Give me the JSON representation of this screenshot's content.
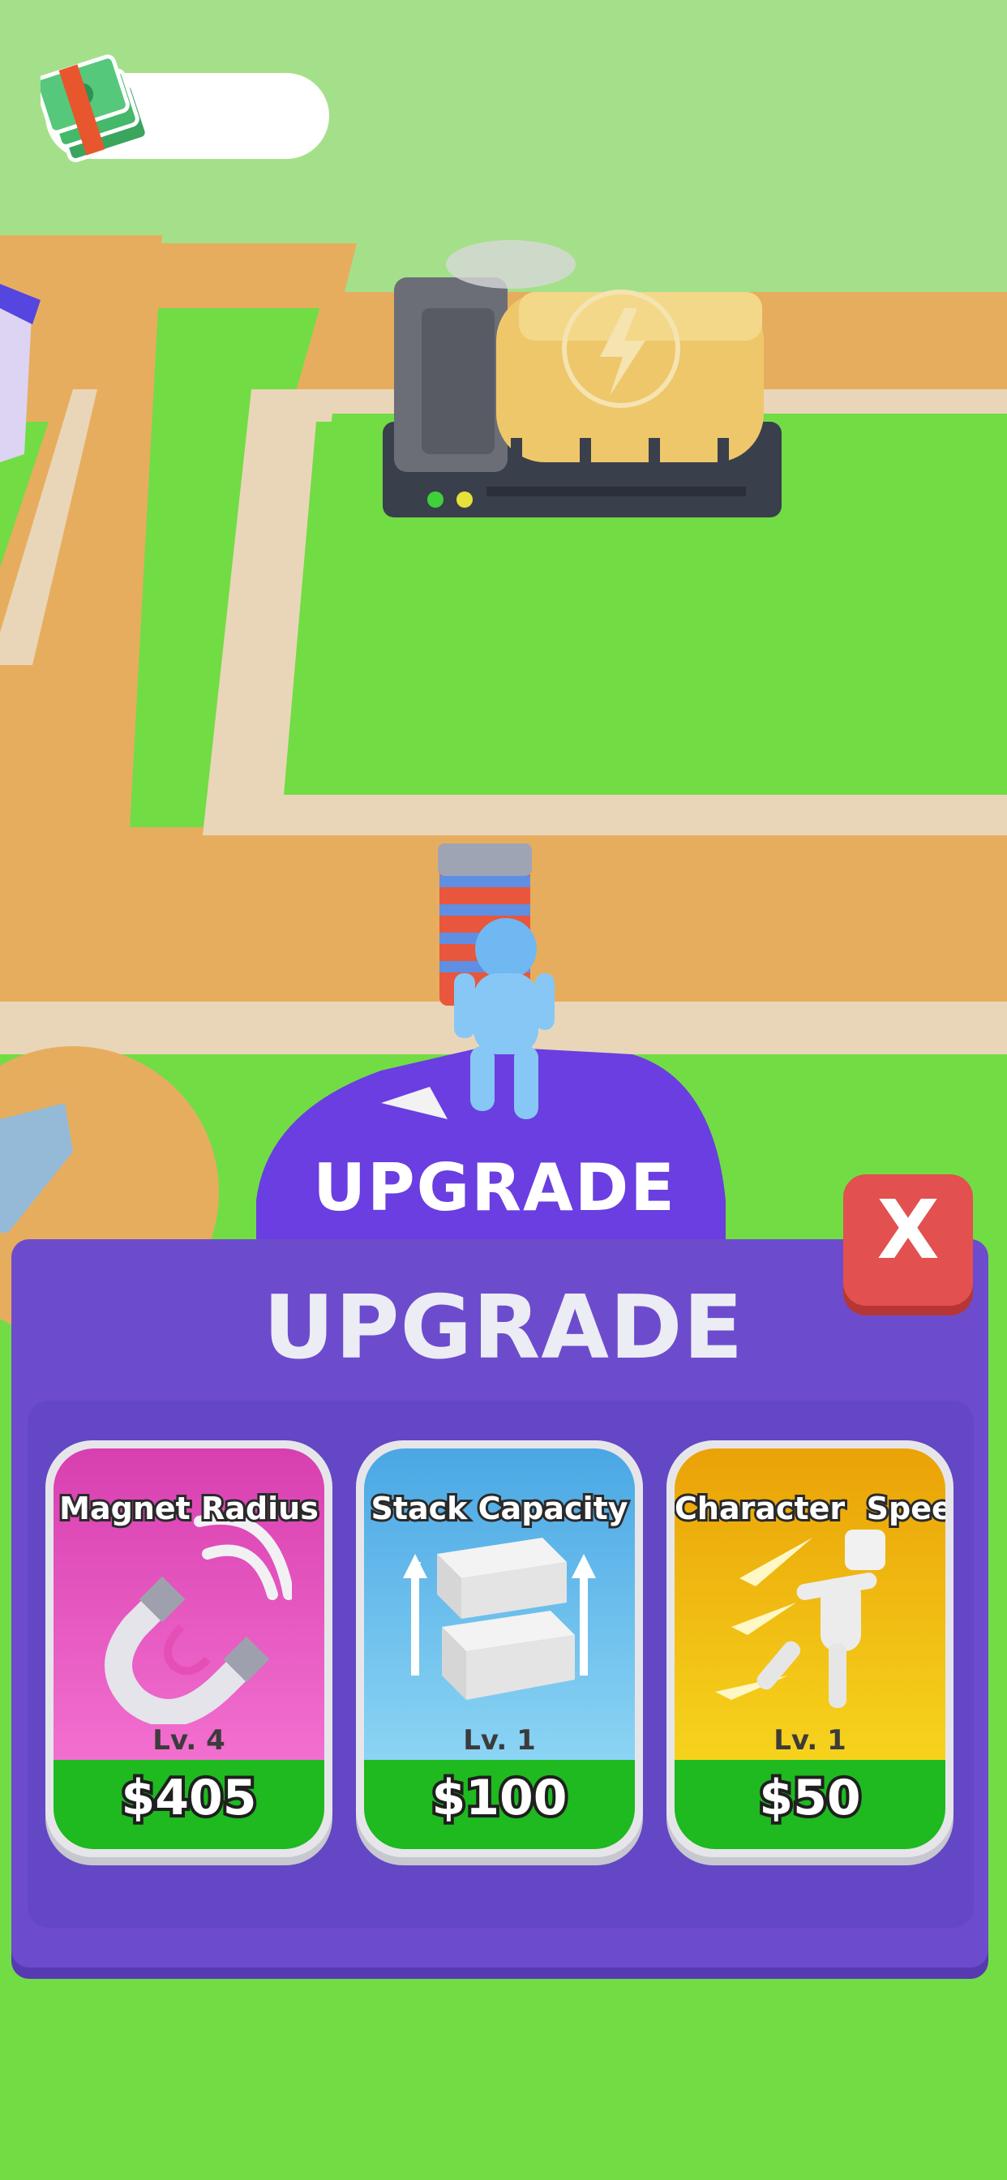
{
  "hud": {
    "cash_amount": ""
  },
  "scene": {
    "floor_pad_label": "UPGRADE"
  },
  "panel": {
    "title": "UPGRADE",
    "close_label": "X",
    "cards": [
      {
        "title": "Magnet Radius",
        "level": "Lv. 4",
        "price": "$405",
        "icon": "magnet-icon"
      },
      {
        "title": "Stack Capacity",
        "level": "Lv. 1",
        "price": "$100",
        "icon": "stacked-blocks-icon"
      },
      {
        "title": "Character  Speed",
        "level": "Lv. 1",
        "price": "$50",
        "icon": "running-figure-icon"
      }
    ]
  },
  "colors": {
    "grass": "#72dc45",
    "path": "#e7ad5e",
    "panel": "#6c4ccd",
    "close_button": "#e2504f",
    "price_band": "#1fb920",
    "magnet_card": "#e54fb5",
    "stack_card": "#5fb9e9",
    "speed_card": "#f0b60c"
  }
}
